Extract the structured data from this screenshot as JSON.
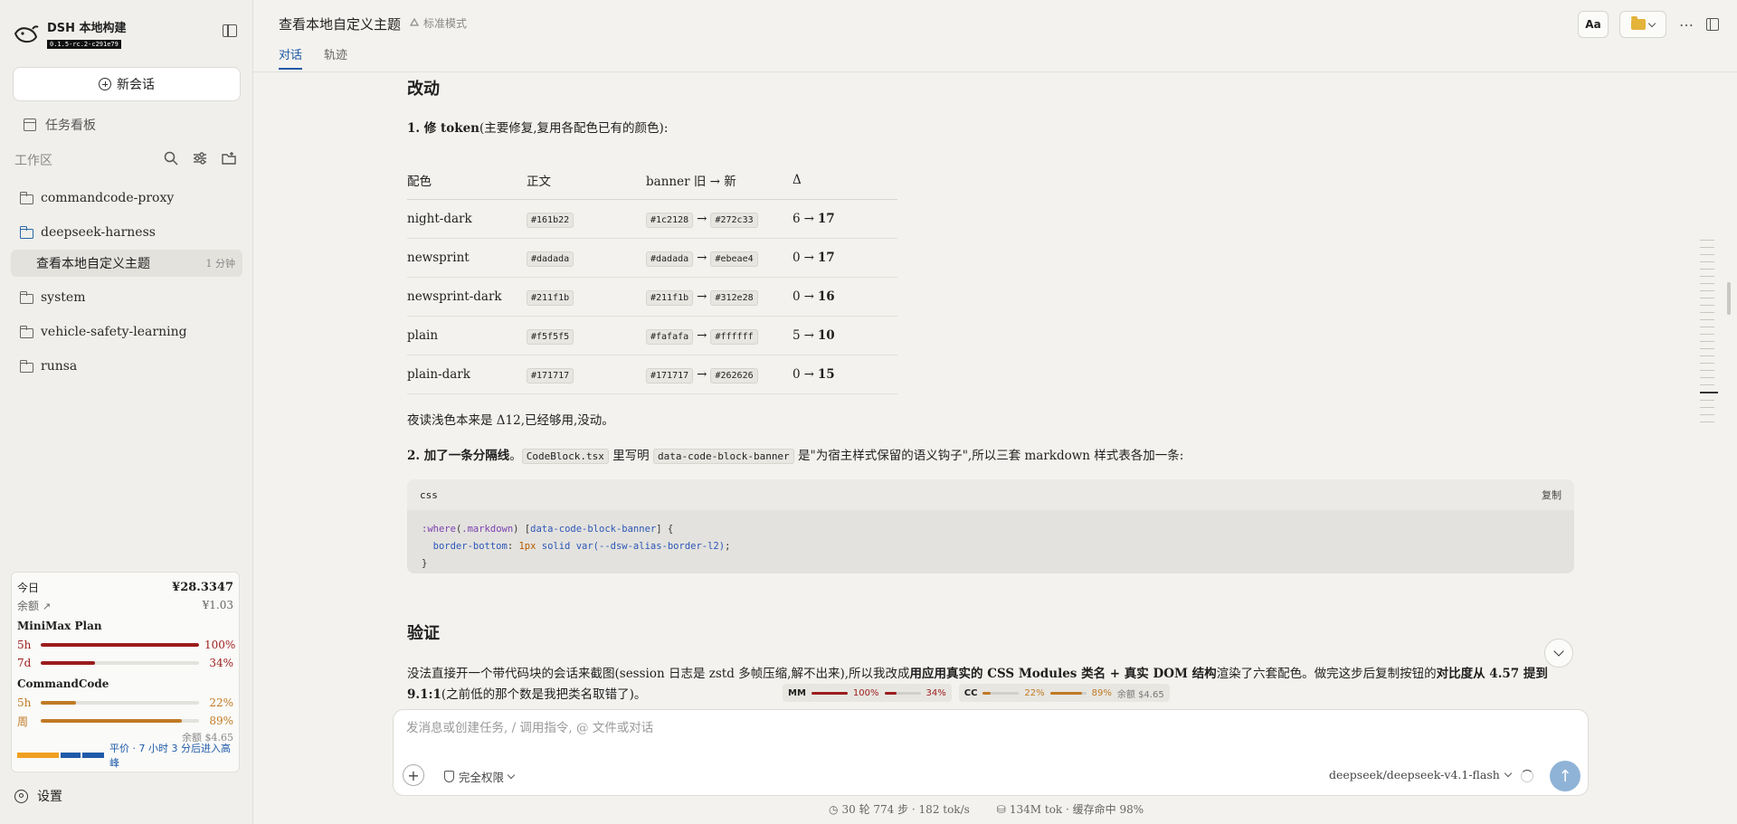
{
  "sidebar": {
    "brand_name": "DSH 本地构建",
    "brand_version": "0.1.5-rc.2-c291e79",
    "new_session": "新会话",
    "task_board": "任务看板",
    "workspace": "工作区",
    "folders_top": [
      "commandcode-proxy",
      "deepseek-harness"
    ],
    "active_session": {
      "title": "查看本地自定义主题",
      "time": "1 分钟"
    },
    "folders_bottom": [
      "system",
      "vehicle-safety-learning",
      "runsa"
    ],
    "usage": {
      "today_label": "今日",
      "today_value": "¥28.3347",
      "balance_label": "余额",
      "balance_value": "¥1.03",
      "plan1": {
        "name": "MiniMax Plan",
        "rows": [
          {
            "label": "5h",
            "pct": "100%",
            "value": 100
          },
          {
            "label": "7d",
            "pct": "34%",
            "value": 34
          }
        ]
      },
      "plan2": {
        "name": "CommandCode",
        "rows": [
          {
            "label": "5h",
            "pct": "22%",
            "value": 22
          },
          {
            "label": "周",
            "pct": "89%",
            "value": 89
          }
        ]
      },
      "remain": "余额 $4.65",
      "tier_text": "平价 · 7 小时 3 分后进入高峰"
    },
    "settings": "设置"
  },
  "header": {
    "title": "查看本地自定义主题",
    "mode": "标准模式",
    "tabs": [
      "对话",
      "轨迹"
    ],
    "font_btn": "Aa"
  },
  "main": {
    "changes_title": "改动",
    "item1": {
      "prefix": "1. 修 token",
      "rest": "(主要修复,复用各配色已有的颜色):"
    },
    "table": {
      "headers": [
        "配色",
        "正文",
        "banner 旧 → 新",
        "Δ"
      ],
      "rows": [
        {
          "name": "night-dark",
          "body": "#161b22",
          "old": "#1c2128",
          "new": "#272c33",
          "d_old": "6",
          "d_new": "17"
        },
        {
          "name": "newsprint",
          "body": "#dadada",
          "old": "#dadada",
          "new": "#ebeae4",
          "d_old": "0",
          "d_new": "17"
        },
        {
          "name": "newsprint-dark",
          "body": "#211f1b",
          "old": "#211f1b",
          "new": "#312e28",
          "d_old": "0",
          "d_new": "16"
        },
        {
          "name": "plain",
          "body": "#f5f5f5",
          "old": "#fafafa",
          "new": "#ffffff",
          "d_old": "5",
          "d_new": "10"
        },
        {
          "name": "plain-dark",
          "body": "#171717",
          "old": "#171717",
          "new": "#262626",
          "d_old": "0",
          "d_new": "15"
        }
      ]
    },
    "note": "夜读浅色本来是 Δ12,已经够用,没动。",
    "item2": {
      "prefix": "2. 加了一条分隔线",
      "sep": "。",
      "code1": "CodeBlock.tsx",
      "mid": " 里写明 ",
      "code2": "data-code-block-banner",
      "rest": " 是\"为宿主样式保留的语义钩子\",所以三套 markdown 样式表各加一条:"
    },
    "code": {
      "lang": "css",
      "copy": "复制",
      "line1_a": ":where",
      "line1_b": "(",
      "line1_c": ".markdown",
      "line1_d": ") [",
      "line1_e": "data-code-block-banner",
      "line1_f": "] {",
      "line2_a": "  border-bottom",
      "line2_b": ": ",
      "line2_c": "1px",
      "line2_d": " solid ",
      "line2_e": "var(--dsw-alias-border-l2)",
      "line2_f": ";",
      "line3": "}"
    },
    "verify_title": "验证",
    "verify_p1_a": "没法直接开一个带代码块的会话来截图(session 日志是 zstd 多帧压缩,解不出来),所以我改成",
    "verify_p1_b": "用应用真实的 CSS Modules 类名 + 真实 DOM 结构",
    "verify_p1_c": "渲染了六套配色。做完这步后复制按钮的",
    "verify_p1_d": "对比度从 4.57 提到",
    "verify_p2_a": "9.1:1",
    "verify_p2_b": "(之前低的那个数是我把类名取错了)。"
  },
  "chips": {
    "mm": {
      "label": "MM",
      "a_pct": "100%",
      "a_val": 100,
      "b_pct": "34%",
      "b_val": 34
    },
    "cc": {
      "label": "CC",
      "a_pct": "22%",
      "a_val": 22,
      "b_pct": "89%",
      "b_val": 89
    },
    "remain": "余额 $4.65"
  },
  "composer": {
    "placeholder": "发消息或创建任务, / 调用指令, @ 文件或对话",
    "permission": "完全权限",
    "model": "deepseek/deepseek-v4.1-flash"
  },
  "footer": {
    "turns": "30 轮 774 步 · 182 tok/s",
    "tokens": "134M tok · 缓存命中 98%"
  },
  "colors": {
    "accent": "#1f5aa8",
    "danger": "#9b1c1c",
    "warn": "#c07a25"
  }
}
